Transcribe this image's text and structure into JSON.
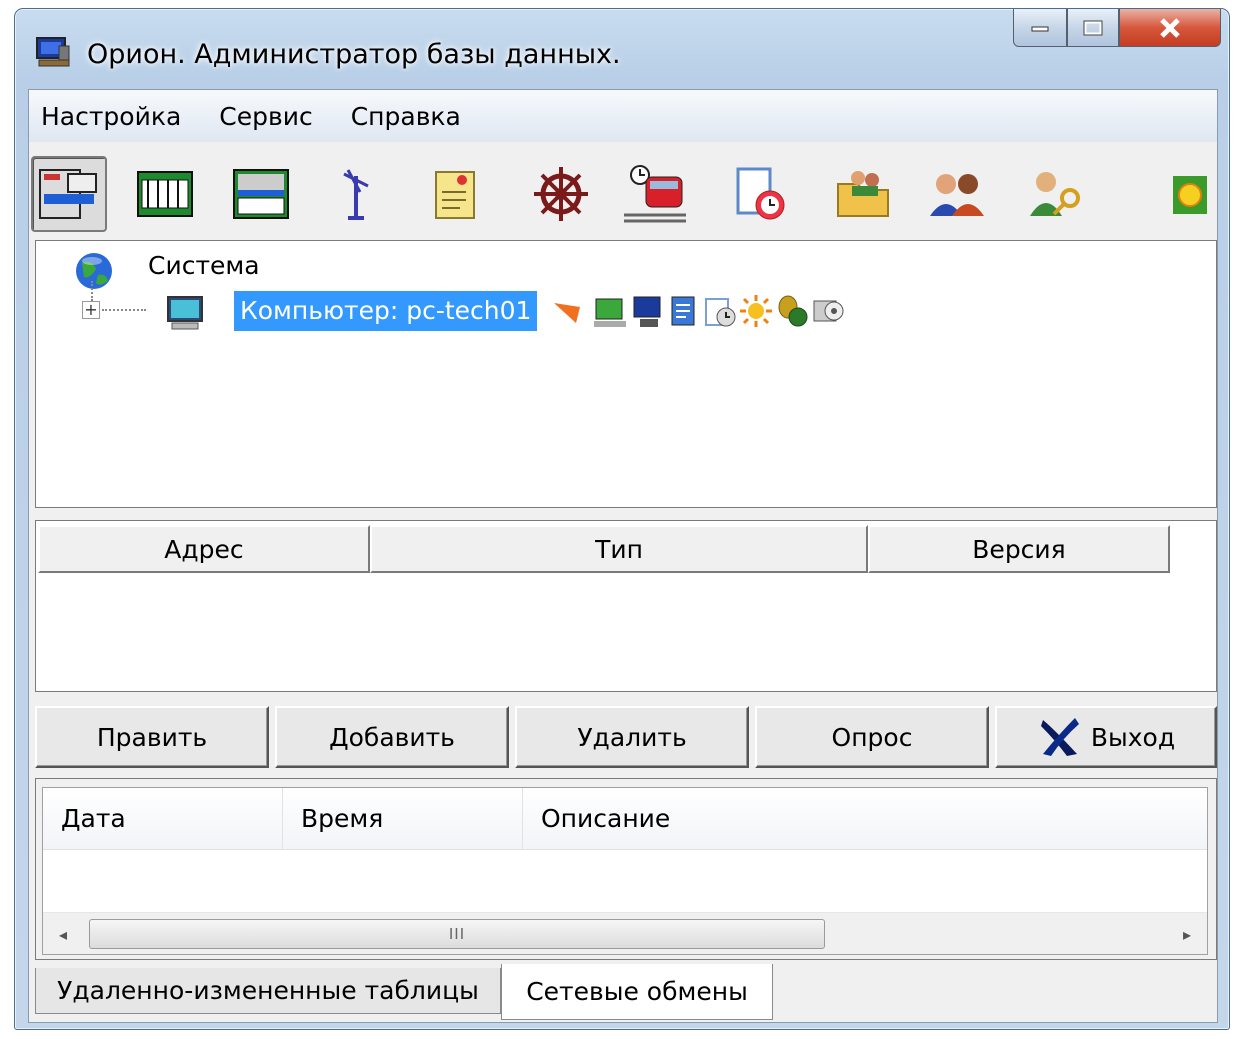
{
  "window": {
    "title": "Орион. Администратор базы данных."
  },
  "menu": {
    "items": [
      "Настройка",
      "Сервис",
      "Справка"
    ]
  },
  "tree": {
    "root_label": "Система",
    "node_label": "Компьютер: pc-tech01"
  },
  "grid": {
    "columns": [
      "Адрес",
      "Тип",
      "Версия"
    ]
  },
  "buttons": {
    "edit": "Править",
    "add": "Добавить",
    "delete": "Удалить",
    "poll": "Опрос",
    "exit": "Выход"
  },
  "log": {
    "columns": [
      "Дата",
      "Время",
      "Описание"
    ],
    "scroll_thumb_glyph": "III",
    "scroll_left": "◂",
    "scroll_right": "▸"
  },
  "tabs": [
    "Удаленно-измененные таблицы",
    "Сетевые обмены"
  ],
  "icons": {
    "toolbar": [
      "devices-icon",
      "controller-icon",
      "device-block-icon",
      "antenna-icon",
      "notepad-icon",
      "ship-wheel-icon",
      "train-schedule-icon",
      "clock-document-icon",
      "users-folder-icon",
      "users-group-icon",
      "user-key-icon",
      "sun-square-icon"
    ],
    "tree_node": [
      "arrow-icon",
      "computer-green-icon",
      "monitor-icon",
      "document-icon",
      "time-page-icon",
      "sun-icon",
      "coins-icon",
      "disk-icon"
    ]
  },
  "colors": {
    "selection": "#3399ff",
    "close_button": "#c8432a",
    "frame": "#b8cfe7"
  }
}
